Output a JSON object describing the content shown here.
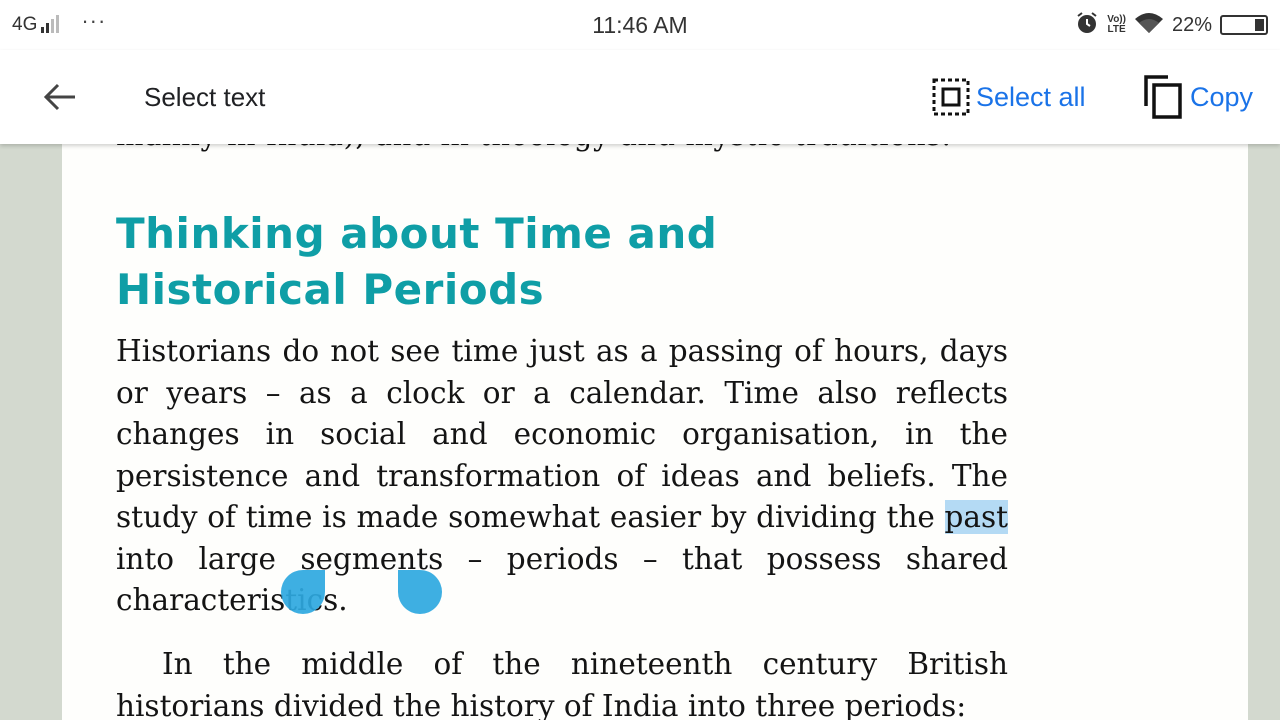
{
  "status_bar": {
    "network": "4G",
    "more": "···",
    "time": "11:46 AM",
    "volte_top": "Vo))",
    "volte_bottom": "LTE",
    "battery_percent": "22%",
    "battery_level": 0.22
  },
  "toolbar": {
    "back_icon": "arrow-back-icon",
    "title": "Select text",
    "select_all_icon": "select-all-icon",
    "select_all_label": "Select all",
    "copy_icon": "copy-icon",
    "copy_label": "Copy",
    "accent_color": "#1a73e8"
  },
  "document": {
    "cutoff_line": "mainly in India), and in theology and mystic traditions.",
    "heading": "Thinking about Time and Historical Periods",
    "heading_color": "#0f9ea6",
    "para1_before": "Historians do not see time just as a passing of hours, days or years – as a clock or a calendar. Time also reflects changes in social and economic organisation, in the persistence and transformation of ideas and beliefs. The study of time is made somewhat easier by dividing the ",
    "para1_selected": "past",
    "para1_after": " into large segments – periods – that possess shared characteristics.",
    "para2": "In the middle of the nineteenth century British historians divided the history of India into three periods:",
    "selection_color": "#b4daf4",
    "handle_color": "#2ea8e0"
  }
}
